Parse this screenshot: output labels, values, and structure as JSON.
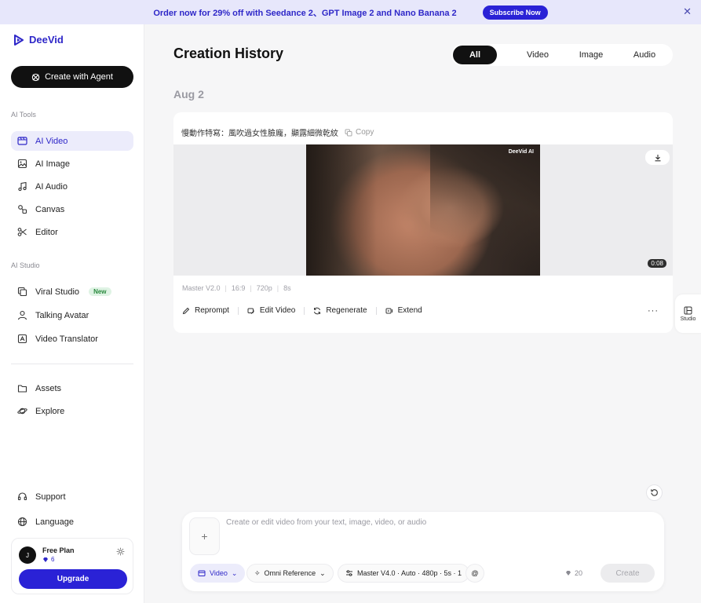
{
  "banner": {
    "text": "Order now for 29% off with Seedance 2、GPT Image 2 and Nano Banana 2",
    "button": "Subscribe Now",
    "close": "✕"
  },
  "brand": {
    "name": "DeeVid",
    "accent": "#2e27c8"
  },
  "sidebar": {
    "agent_button": "Create with Agent",
    "tools_label": "AI Tools",
    "tools": [
      {
        "label": "AI Video",
        "icon": "video-icon",
        "active": true
      },
      {
        "label": "AI Image",
        "icon": "image-icon"
      },
      {
        "label": "AI Audio",
        "icon": "music-icon"
      },
      {
        "label": "Canvas",
        "icon": "canvas-icon"
      },
      {
        "label": "Editor",
        "icon": "scissors-icon"
      }
    ],
    "studio_label": "AI Studio",
    "studio": [
      {
        "label": "Viral Studio",
        "icon": "copy-icon",
        "badge": "New"
      },
      {
        "label": "Talking Avatar",
        "icon": "user-icon"
      },
      {
        "label": "Video Translator",
        "icon": "translate-icon"
      }
    ],
    "library": [
      {
        "label": "Assets",
        "icon": "folder-icon"
      },
      {
        "label": "Explore",
        "icon": "planet-icon"
      }
    ],
    "bottom": [
      {
        "label": "Support",
        "icon": "headset-icon"
      },
      {
        "label": "Language",
        "icon": "globe-icon"
      }
    ],
    "plan": {
      "avatar": "J",
      "name": "Free Plan",
      "credits": "6",
      "upgrade": "Upgrade"
    }
  },
  "main": {
    "title": "Creation History",
    "filters": [
      "All",
      "Video",
      "Image",
      "Audio"
    ],
    "active_filter": "All",
    "date": "Aug 2",
    "card": {
      "prompt": "慢動作特寫：風吹過女性臉龐，顯露細微乾紋",
      "copy": "Copy",
      "watermark": "DeeVid AI",
      "duration": "0:08",
      "meta": [
        "Master V2.0",
        "16:9",
        "720p",
        "8s"
      ],
      "actions": [
        "Reprompt",
        "Edit Video",
        "Regenerate",
        "Extend"
      ],
      "more": "···"
    },
    "studio_tab": "Studio"
  },
  "composer": {
    "placeholder": "Create or edit video from your text, image, video, or audio",
    "add": "+",
    "mode": "Video",
    "reference": "Omni Reference",
    "settings": "Master V4.0 · Auto · 480p · 5s · 1",
    "mention": "@",
    "cost": "20",
    "create": "Create"
  }
}
